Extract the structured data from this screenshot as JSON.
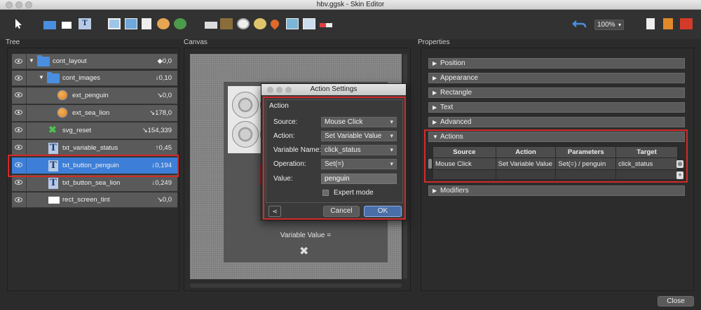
{
  "window": {
    "title": "hbv.ggsk - Skin Editor"
  },
  "toolbar": {
    "zoom": "100%"
  },
  "panels": {
    "tree": "Tree",
    "canvas": "Canvas",
    "properties": "Properties"
  },
  "tree": {
    "rows": [
      {
        "label": "cont_layout",
        "value": "◆0,0",
        "icon": "folder-icon"
      },
      {
        "label": "cont_images",
        "value": "↓0,10",
        "icon": "folder-icon"
      },
      {
        "label": "ext_penguin",
        "value": "↘0,0",
        "icon": "globe-icon"
      },
      {
        "label": "ext_sea_lion",
        "value": "↘178,0",
        "icon": "globe-icon"
      },
      {
        "label": "svg_reset",
        "value": "↘154,339",
        "icon": "x-icon"
      },
      {
        "label": "txt_variable_status",
        "value": "↑0,45",
        "icon": "text-icon"
      },
      {
        "label": "txt_button_penguin",
        "value": "↓0,194",
        "icon": "text-icon"
      },
      {
        "label": "txt_button_sea_lion",
        "value": "↓0,249",
        "icon": "text-icon"
      },
      {
        "label": "rect_screen_tint",
        "value": "↘0,0",
        "icon": "rect-icon"
      }
    ]
  },
  "canvas": {
    "variable_text": "Variable Value ="
  },
  "dialog": {
    "title": "Action Settings",
    "group": "Action",
    "source_label": "Source:",
    "source_value": "Mouse Click",
    "action_label": "Action:",
    "action_value": "Set Variable Value",
    "varname_label": "Variable Name:",
    "varname_value": "click_status",
    "operation_label": "Operation:",
    "operation_value": "Set(=)",
    "value_label": "Value:",
    "value_value": "penguin",
    "expert_label": "Expert mode",
    "cancel": "Cancel",
    "ok": "OK"
  },
  "properties": {
    "sections": [
      "Position",
      "Appearance",
      "Rectangle",
      "Text",
      "Advanced",
      "Actions",
      "Modifiers"
    ],
    "table": {
      "headers": [
        "Source",
        "Action",
        "Parameters",
        "Target"
      ],
      "row": [
        "Mouse Click",
        "Set Variable Value",
        "Set(=) / penguin",
        "click_status"
      ]
    }
  },
  "footer": {
    "close": "Close"
  }
}
